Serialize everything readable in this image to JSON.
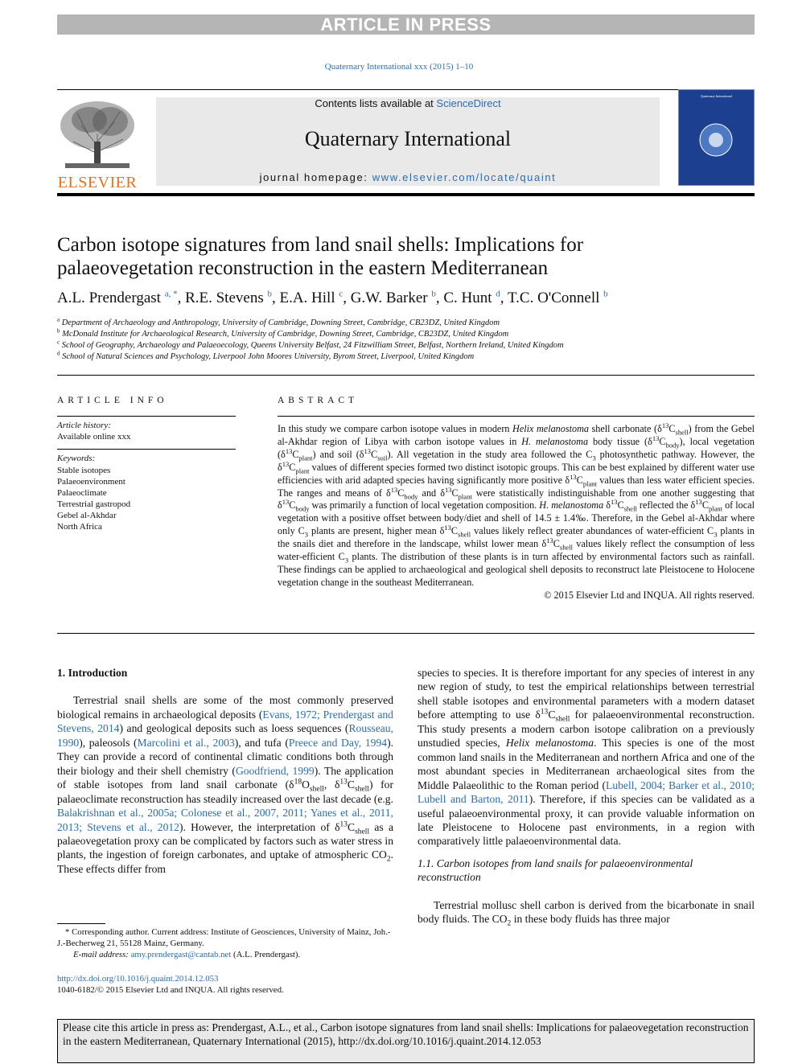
{
  "banner": "ARTICLE IN PRESS",
  "journal_ref": "Quaternary International xxx (2015) 1–10",
  "header": {
    "contents_prefix": "Contents lists available at ",
    "contents_link": "ScienceDirect",
    "journal_title": "Quaternary International",
    "homepage_prefix": "journal homepage: ",
    "homepage_link": "www.elsevier.com/locate/quaint",
    "publisher_logo": "ELSEVIER",
    "cover_label": "Quaternary International"
  },
  "title": "Carbon isotope signatures from land snail shells: Implications for palaeovegetation reconstruction in the eastern Mediterranean",
  "authors": "A.L. Prendergast ^{a, *}, R.E. Stevens ^{b}, E.A. Hill ^{c}, G.W. Barker ^{b}, C. Hunt ^{d}, T.C. O'Connell ^{b}",
  "affiliations": [
    "^{a} Department of Archaeology and Anthropology, University of Cambridge, Downing Street, Cambridge, CB23DZ, United Kingdom",
    "^{b} McDonald Institute for Archaeological Research, University of Cambridge, Downing Street, Cambridge, CB23DZ, United Kingdom",
    "^{c} School of Geography, Archaeology and Palaeoecology, Queens University Belfast, 24 Fitzwilliam Street, Belfast, Northern Ireland, United Kingdom",
    "^{d} School of Natural Sciences and Psychology, Liverpool John Moores University, Byrom Street, Liverpool, United Kingdom"
  ],
  "article_info": {
    "heading": "ARTICLE INFO",
    "history_label": "Article history:",
    "history": "Available online xxx",
    "keywords_label": "Keywords:",
    "keywords": [
      "Stable isotopes",
      "Palaeoenvironment",
      "Palaeoclimate",
      "Terrestrial gastropod",
      "Gebel al-Akhdar",
      "North Africa"
    ]
  },
  "abstract": {
    "heading": "ABSTRACT",
    "text": "In this study we compare carbon isotope values in modern *Helix melanostoma* shell carbonate (δ^{13}C_{shell}) from the Gebel al-Akhdar region of Libya with carbon isotope values in *H. melanostoma* body tissue (δ^{13}C_{body}), local vegetation (δ^{13}C_{plant}) and soil (δ^{13}C_{soil}). All vegetation in the study area followed the C_{3} photosynthetic pathway. However, the δ^{13}C_{plant} values of different species formed two distinct isotopic groups. This can be best explained by different water use efficiencies with arid adapted species having significantly more positive δ^{13}C_{plant} values than less water efficient species. The ranges and means of δ^{13}C_{body} and δ^{13}C_{plant} were statistically indistinguishable from one another suggesting that δ^{13}C_{body} was primarily a function of local vegetation composition. *H. melanostoma* δ^{13}C_{shell} reflected the δ^{13}C_{plant} of local vegetation with a positive offset between body/diet and shell of 14.5 ± 1.4‰. Therefore, in the Gebel al-Akhdar where only C_{3} plants are present, higher mean δ^{13}C_{shell} values likely reflect greater abundances of water-efficient C_{3} plants in the snails diet and therefore in the landscape, whilst lower mean δ^{13}C_{shell} values likely reflect the consumption of less water-efficient C_{3} plants. The distribution of these plants is in turn affected by environmental factors such as rainfall. These findings can be applied to archaeological and geological shell deposits to reconstruct late Pleistocene to Holocene vegetation change in the southeast Mediterranean.",
    "copyright": "© 2015 Elsevier Ltd and INQUA. All rights reserved."
  },
  "intro": {
    "heading": "1.  Introduction",
    "p1": "Terrestrial snail shells are some of the most commonly preserved biological remains in archaeological deposits ([Evans, 1972; Prendergast and Stevens, 2014]) and geological deposits such as loess sequences ([Rousseau, 1990]), paleosols ([Marcolini et al., 2003]), and tufa ([Preece and Day, 1994]). They can provide a record of continental climatic conditions both through their biology and their shell chemistry ([Goodfriend, 1999]). The application of stable isotopes from land snail carbonate (δ^{18}O_{shell}, δ^{13}C_{shell}) for palaeoclimate reconstruction has steadily increased over the last decade (e.g. [Balakrishnan et al., 2005a; Colonese et al., 2007, 2011; Yanes et al., 2011, 2013; Stevens et al., 2012]). However, the interpretation of δ^{13}C_{shell} as a palaeovegetation proxy can be complicated by factors such as water stress in plants, the ingestion of foreign carbonates, and uptake of atmospheric CO_{2}. These effects differ from",
    "p2": "species to species. It is therefore important for any species of interest in any new region of study, to test the empirical relationships between terrestrial shell stable isotopes and environmental parameters with a modern dataset before attempting to use δ^{13}C_{shell} for palaeoenvironmental reconstruction. This study presents a modern carbon isotope calibration on a previously unstudied species, *Helix melanostoma*. This species is one of the most common land snails in the Mediterranean and northern Africa and one of the most abundant species in Mediterranean archaeological sites from the Middle Palaeolithic to the Roman period ([Lubell, 2004; Barker et al., 2010; Lubell and Barton, 2011]). Therefore, if this species can be validated as a useful palaeoenvironmental proxy, it can provide valuable information on late Pleistocene to Holocene past environments, in a region with comparatively little palaeoenvironmental data.",
    "subheading": "1.1.  Carbon isotopes from land snails for palaeoenvironmental reconstruction",
    "p3": "Terrestrial mollusc shell carbon is derived from the bicarbonate in snail body fluids. The CO_{2} in these body fluids has three major"
  },
  "footnote": {
    "corresponding": "* Corresponding author. Current address: Institute of Geosciences, University of Mainz, Joh.-J.-Becherweg 21, 55128 Mainz, Germany.",
    "email_label": "E-mail address: ",
    "email": "amy.prendergast@cantab.net",
    "email_suffix": " (A.L. Prendergast).",
    "doi": "http://dx.doi.org/10.1016/j.quaint.2014.12.053",
    "issn": "1040-6182/© 2015 Elsevier Ltd and INQUA. All rights reserved."
  },
  "citation_box": "Please cite this article in press as: Prendergast, A.L., et al., Carbon isotope signatures from land snail shells: Implications for palaeovegetation reconstruction in the eastern Mediterranean, Quaternary International (2015), http://dx.doi.org/10.1016/j.quaint.2014.12.053"
}
